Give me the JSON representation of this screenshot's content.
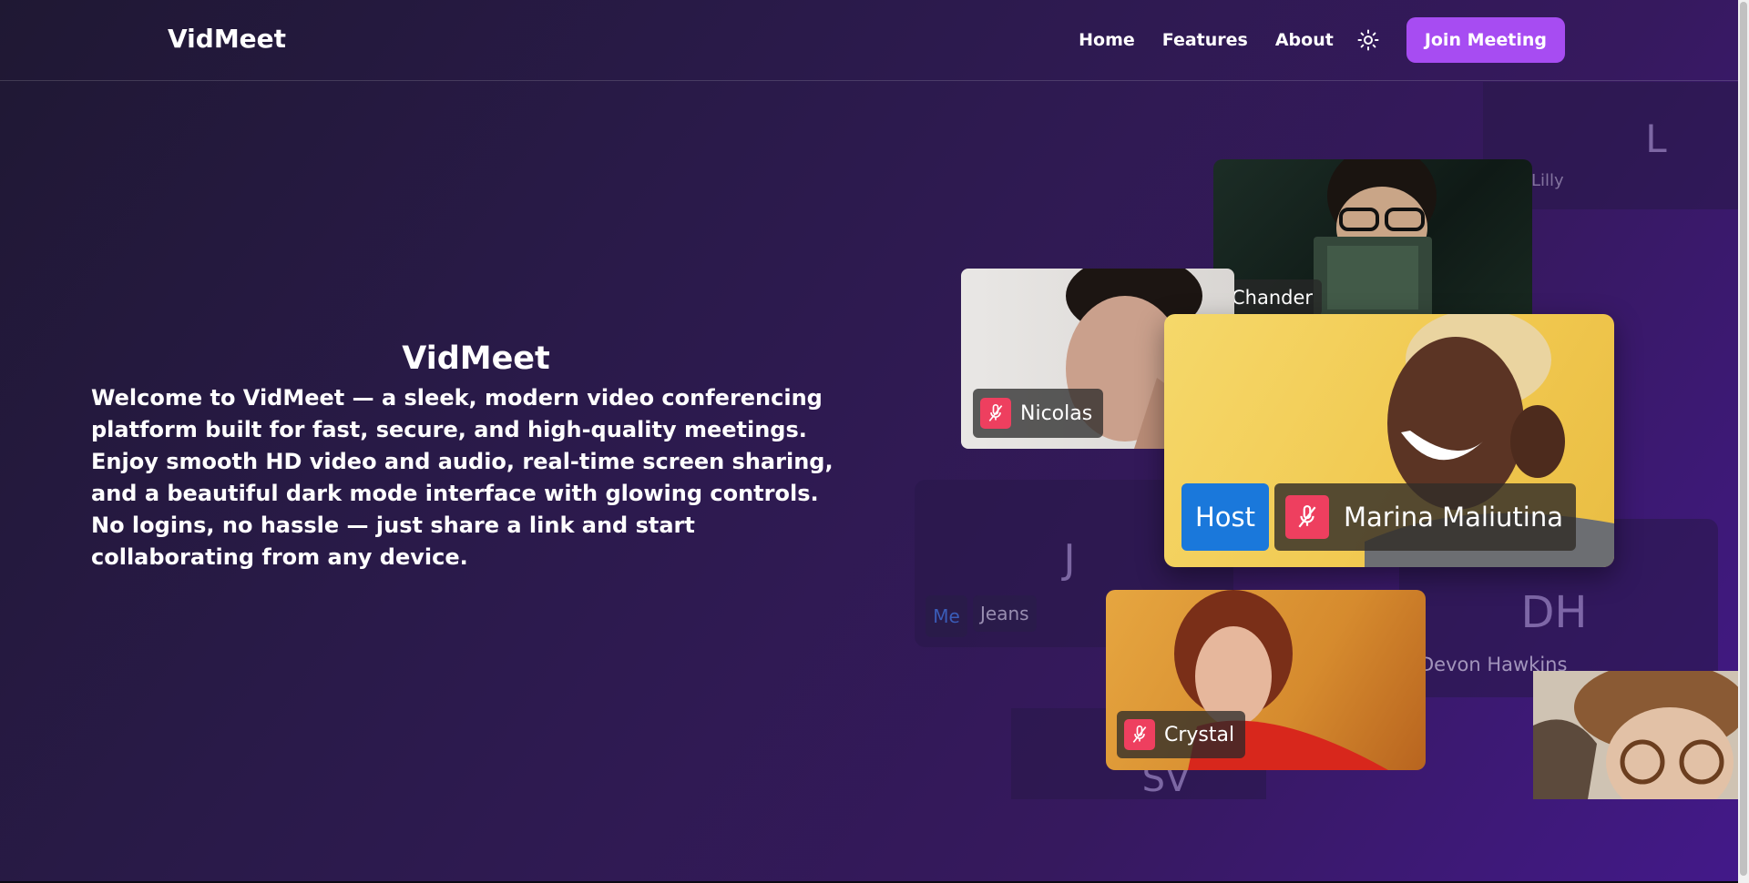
{
  "header": {
    "logo": "VidMeet",
    "nav": [
      {
        "label": "Home"
      },
      {
        "label": "Features"
      },
      {
        "label": "About"
      }
    ],
    "theme_icon": "sun-icon",
    "join_label": "Join Meeting"
  },
  "hero": {
    "title": "VidMeet",
    "description": "Welcome to VidMeet — a sleek, modern video conferencing platform built for fast, secure, and high-quality meetings. Enjoy smooth HD video and audio, real-time screen sharing, and a beautiful dark mode interface with glowing controls. No logins, no hassle — just share a link and start collaborating from any device."
  },
  "participants": {
    "lilly": {
      "initial": "L",
      "name": "Lilly"
    },
    "chander": {
      "name": "Chander"
    },
    "nicolas": {
      "name": "Nicolas"
    },
    "marina": {
      "name": "Marina Maliutina",
      "badge": "Host"
    },
    "jeans": {
      "initial": "J",
      "name": "Jeans",
      "badge": "Me"
    },
    "devon": {
      "initial": "DH",
      "name": "Devon Hawkins"
    },
    "crystal": {
      "name": "Crystal"
    },
    "sv": {
      "initial": "SV"
    }
  },
  "icons": {
    "mic_muted": "mic-off-icon"
  },
  "colors": {
    "accent": "#a74cf2",
    "host": "#1a78db",
    "muted": "#ee3f5f"
  }
}
